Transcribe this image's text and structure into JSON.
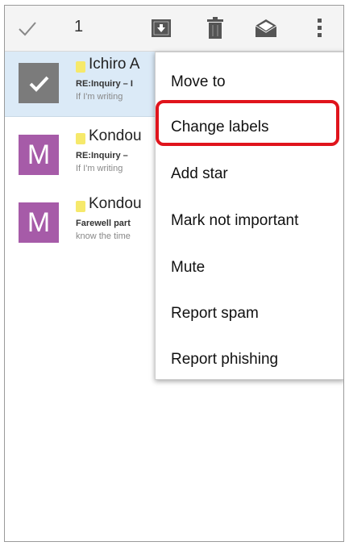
{
  "actionbar": {
    "selected_count": "1",
    "icons": [
      "check-icon",
      "archive-icon",
      "delete-icon",
      "mark-unread-icon",
      "overflow-icon"
    ]
  },
  "emails": [
    {
      "sender": "Ichiro A",
      "subject": "RE:Inquiry – I",
      "snippet": "If I'm writing",
      "avatar": "check",
      "selected": true
    },
    {
      "sender": "Kondou",
      "subject": "RE:Inquiry –",
      "snippet": "If I'm writing",
      "avatar": "M",
      "selected": false
    },
    {
      "sender": "Kondou",
      "subject": "Farewell part",
      "snippet": "know the time",
      "avatar": "M",
      "selected": false
    }
  ],
  "menu": {
    "items": [
      "Move to",
      "Change labels",
      "Add star",
      "Mark not important",
      "Mute",
      "Report spam",
      "Report phishing"
    ],
    "highlighted": "Change labels"
  },
  "colors": {
    "highlight": "#e0141c",
    "avatar_letter": "#a65ba8",
    "avatar_check": "#7b7b7b",
    "selected_row": "#dbeaf7",
    "star": "#f6e96b"
  }
}
